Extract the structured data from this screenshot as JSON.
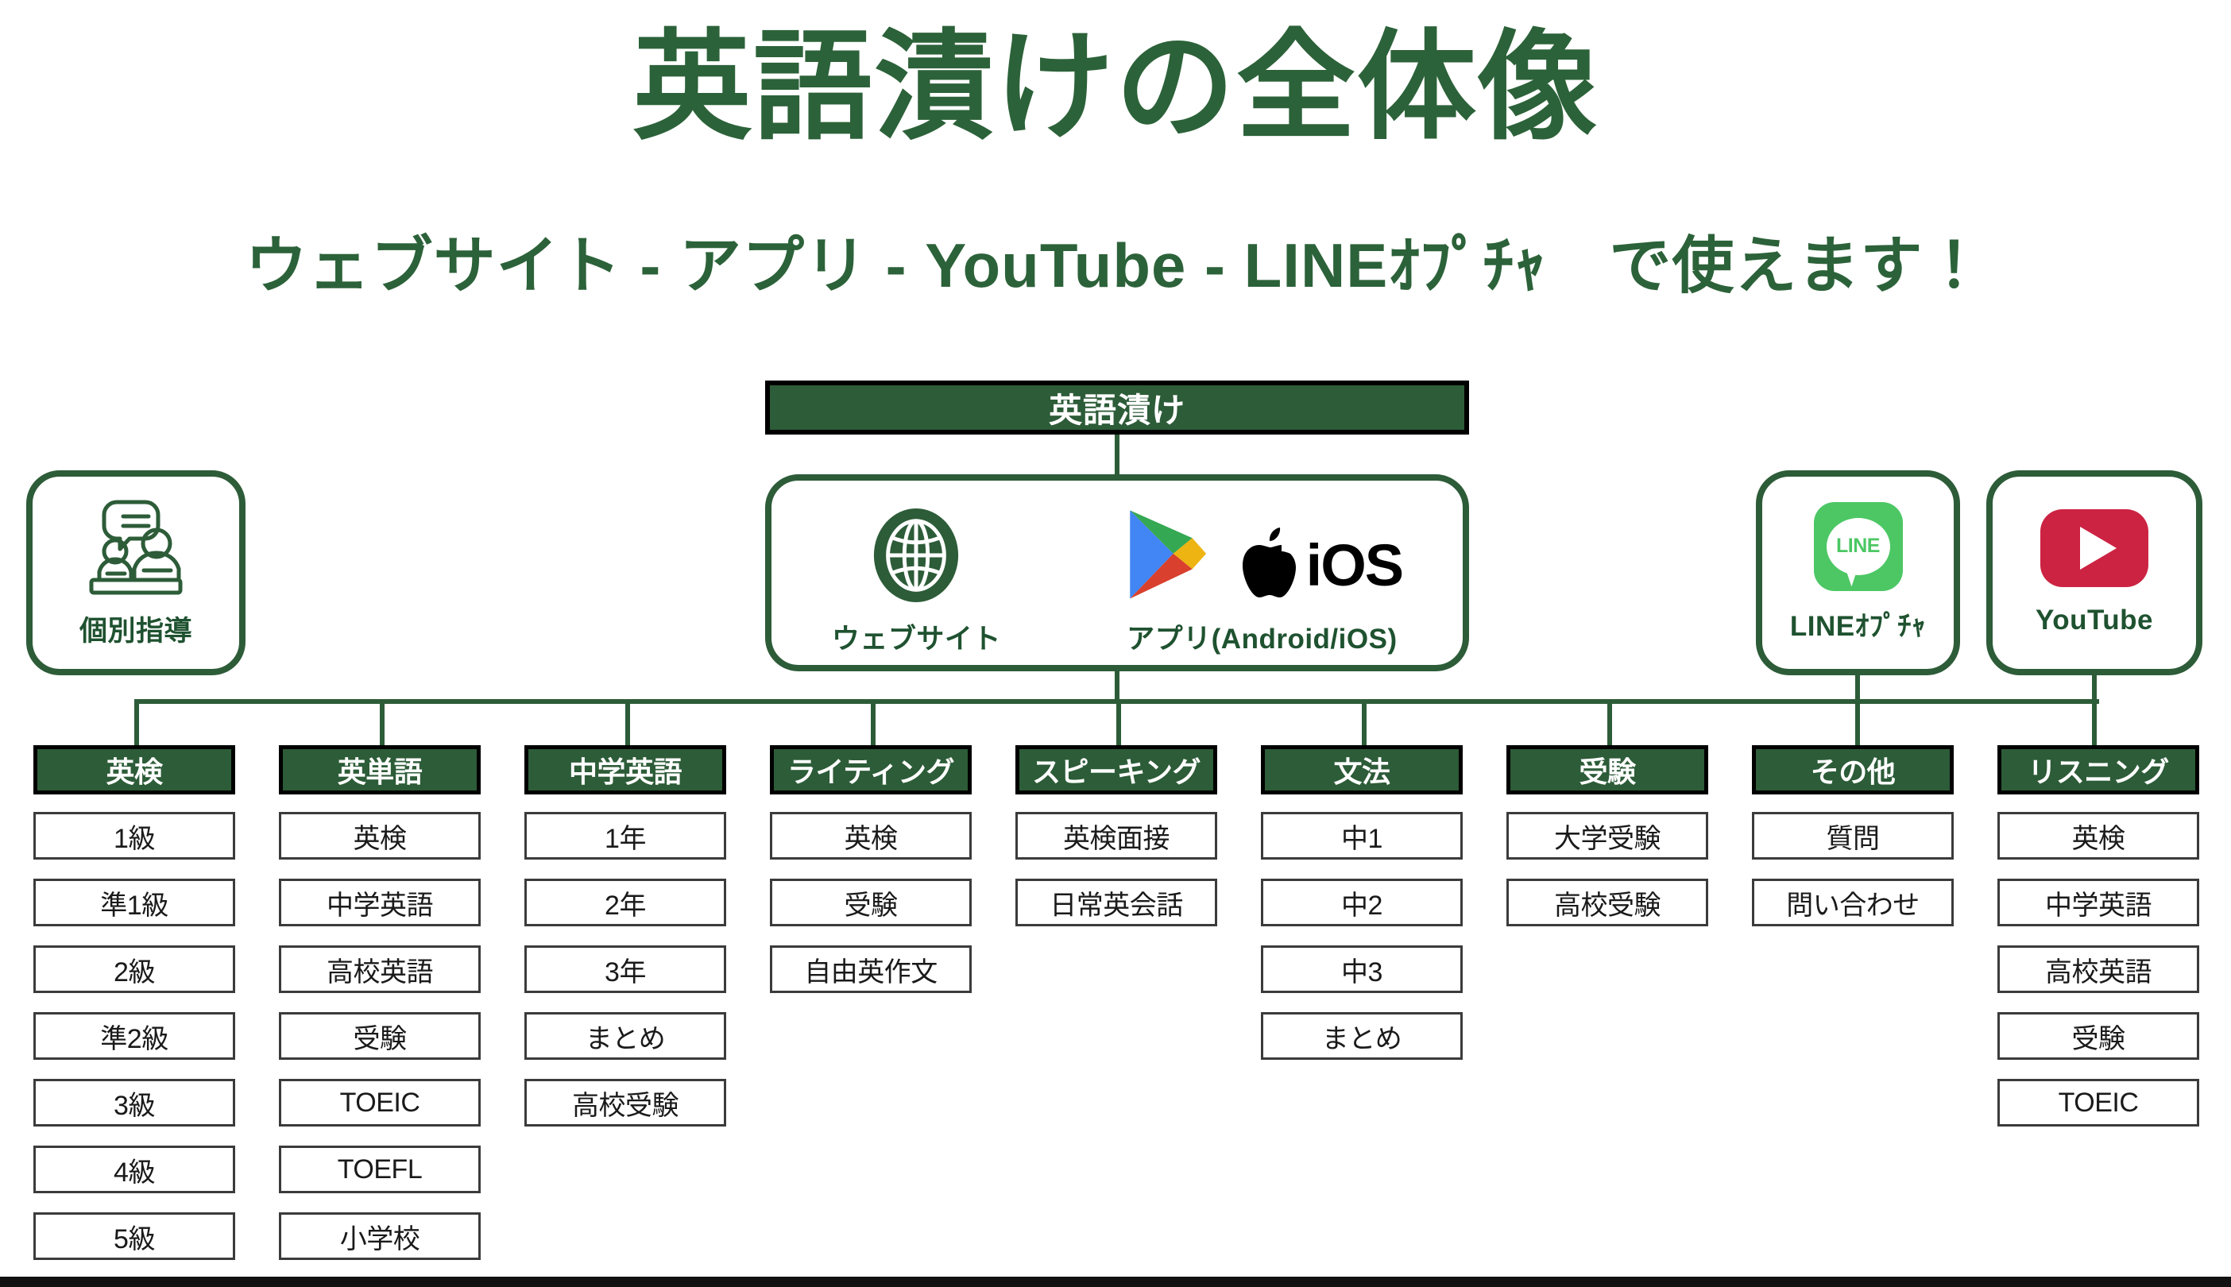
{
  "header": {
    "title": "英語漬けの全体像",
    "subtitle": "ウェブサイト - アプリ - YouTube - LINEｵﾌﾟﾁｬ　で使えます！"
  },
  "root": {
    "label": "英語漬け"
  },
  "cards": {
    "tutoring": {
      "label": "個別指導",
      "icon": "tutoring-icon"
    },
    "platforms": [
      {
        "label": "ウェブサイト",
        "icon": "globe-icon"
      },
      {
        "label": "アプリ(Android/iOS)",
        "icon": "google-play-icon",
        "icon2": "apple-ios-icon",
        "ios_text": "iOS"
      }
    ],
    "line": {
      "label": "LINEｵﾌﾟﾁｬ",
      "icon": "line-icon",
      "icon_word": "LINE"
    },
    "youtube": {
      "label": "YouTube",
      "icon": "youtube-icon"
    }
  },
  "columns": [
    {
      "header": "英検",
      "items": [
        "1級",
        "準1級",
        "2級",
        "準2級",
        "3級",
        "4級",
        "5級"
      ]
    },
    {
      "header": "英単語",
      "items": [
        "英検",
        "中学英語",
        "高校英語",
        "受験",
        "TOEIC",
        "TOEFL",
        "小学校"
      ]
    },
    {
      "header": "中学英語",
      "items": [
        "1年",
        "2年",
        "3年",
        "まとめ",
        "高校受験"
      ]
    },
    {
      "header": "ライティング",
      "items": [
        "英検",
        "受験",
        "自由英作文"
      ]
    },
    {
      "header": "スピーキング",
      "items": [
        "英検面接",
        "日常英会話"
      ]
    },
    {
      "header": "文法",
      "items": [
        "中1",
        "中2",
        "中3",
        "まとめ"
      ]
    },
    {
      "header": "受験",
      "items": [
        "大学受験",
        "高校受験"
      ]
    },
    {
      "header": "その他",
      "items": [
        "質問",
        "問い合わせ"
      ]
    },
    {
      "header": "リスニング",
      "items": [
        "英検",
        "中学英語",
        "高校英語",
        "受験",
        "TOEIC"
      ]
    }
  ],
  "colors": {
    "brand_green": "#2d5c38",
    "title_green": "#2c6239",
    "line_green": "#4CC764",
    "youtube_red": "#CC2342",
    "box_border": "#3b3b3b"
  }
}
